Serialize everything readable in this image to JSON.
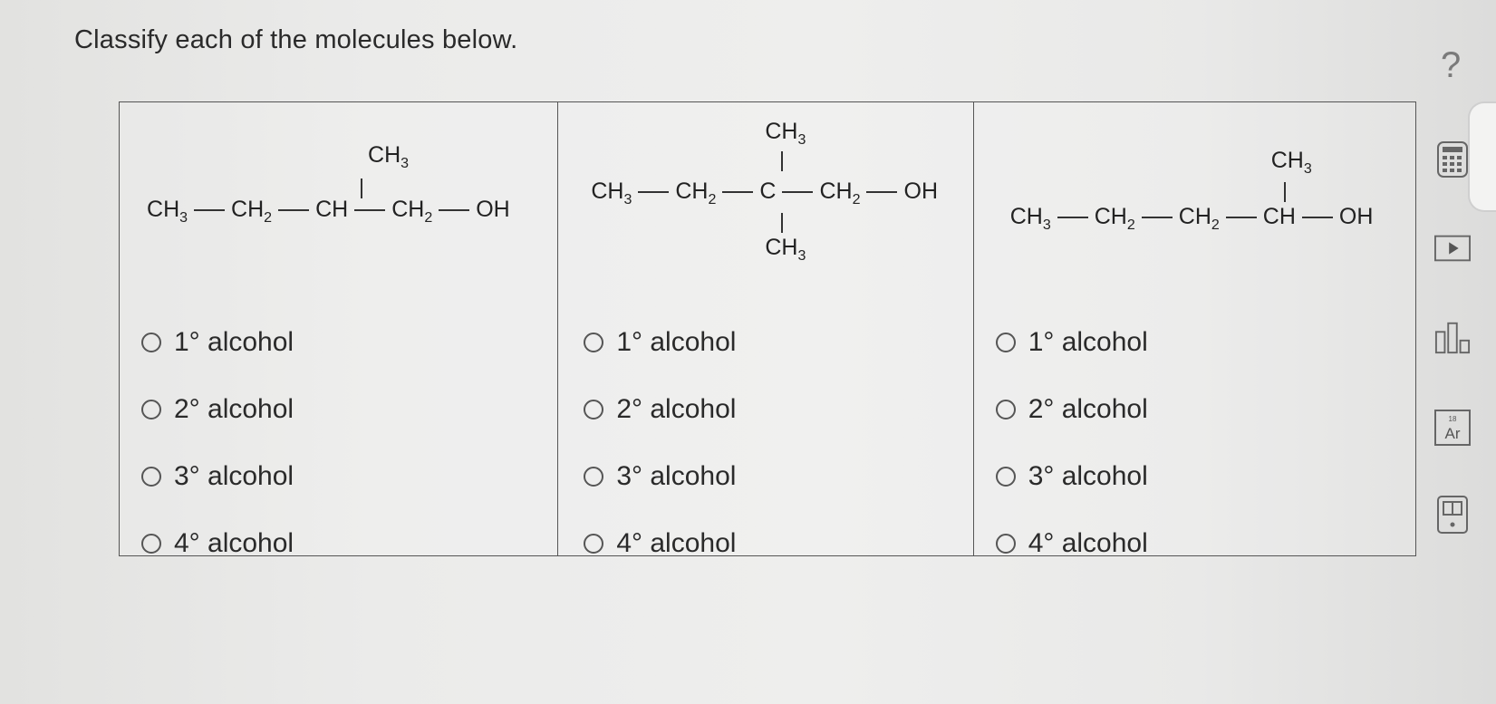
{
  "question": "Classify each of the molecules below.",
  "help_label": "?",
  "molecules": [
    {
      "main": [
        "CH3",
        "CH2",
        "CH",
        "CH2",
        "OH"
      ],
      "top": "CH3"
    },
    {
      "main": [
        "CH3",
        "CH2",
        "C",
        "CH2",
        "OH"
      ],
      "top": "CH3",
      "bottom": "CH3"
    },
    {
      "main": [
        "CH3",
        "CH2",
        "CH2",
        "CH",
        "OH"
      ],
      "top": "CH3"
    }
  ],
  "option_labels": [
    "1° alcohol",
    "2° alcohol",
    "3° alcohol",
    "4° alcohol"
  ],
  "tools": [
    "calculator-icon",
    "video-icon",
    "bar-chart-icon",
    "periodic-table-icon",
    "reference-book-icon"
  ],
  "tool_texts": {
    "periodic_number": "18",
    "periodic_symbol": "Ar"
  }
}
